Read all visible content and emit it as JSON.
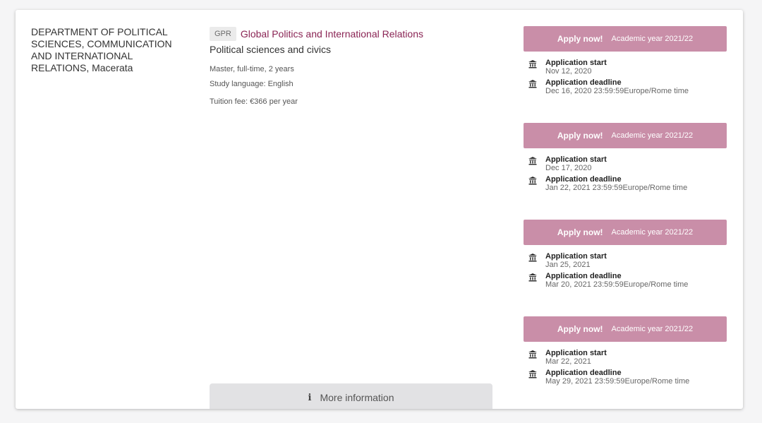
{
  "department": "DEPARTMENT OF POLITICAL SCIENCES, COMMUNICATION AND INTERNATIONAL RELATIONS, Macerata",
  "program": {
    "code": "GPR",
    "title": "Global Politics and International Relations",
    "subtitle": "Political sciences and civics",
    "degree": "Master, full-time, 2 years",
    "language": "Study language: English",
    "fee": "Tuition fee: €366 per year"
  },
  "more_button": {
    "icon": "i",
    "label": "More information"
  },
  "sessions": [
    {
      "apply_label": "Apply now!",
      "year": "Academic year 2021/22",
      "start_label": "Application start",
      "start_date": "Nov 12, 2020",
      "deadline_label": "Application deadline",
      "deadline": "Dec 16, 2020 23:59:59Europe/Rome time"
    },
    {
      "apply_label": "Apply now!",
      "year": "Academic year 2021/22",
      "start_label": "Application start",
      "start_date": "Dec 17, 2020",
      "deadline_label": "Application deadline",
      "deadline": "Jan 22, 2021 23:59:59Europe/Rome time"
    },
    {
      "apply_label": "Apply now!",
      "year": "Academic year 2021/22",
      "start_label": "Application start",
      "start_date": "Jan 25, 2021",
      "deadline_label": "Application deadline",
      "deadline": "Mar 20, 2021 23:59:59Europe/Rome time"
    },
    {
      "apply_label": "Apply now!",
      "year": "Academic year 2021/22",
      "start_label": "Application start",
      "start_date": "Mar 22, 2021",
      "deadline_label": "Application deadline",
      "deadline": "May 29, 2021 23:59:59Europe/Rome time"
    }
  ],
  "colors": {
    "accent": "#8a2454",
    "apply_button": "#c98ea8",
    "more_button": "#e2e2e4"
  },
  "icons": {
    "date_icon": "bank-icon",
    "more_info_icon": "info-icon"
  }
}
